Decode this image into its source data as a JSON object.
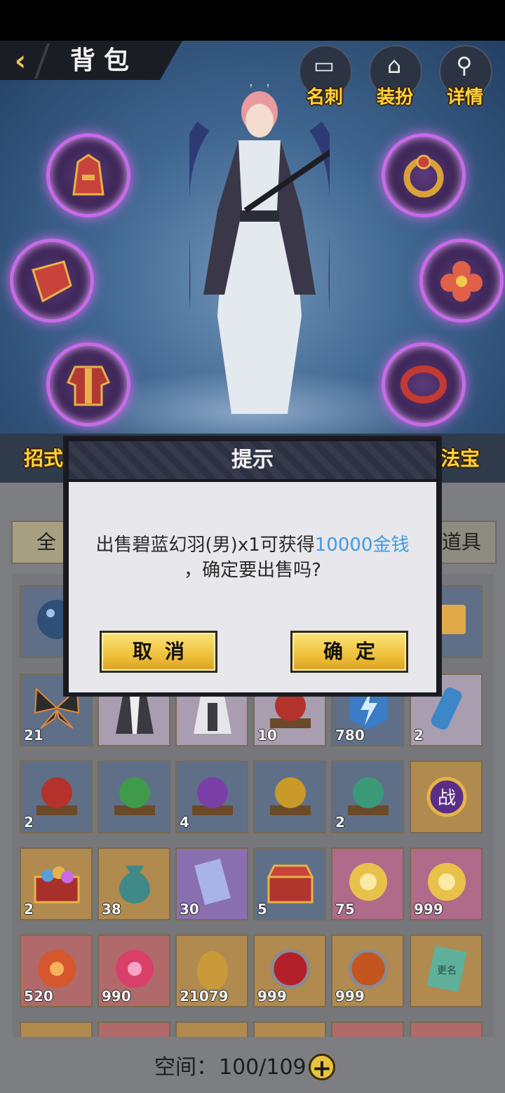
{
  "header": {
    "title": "背包",
    "back_icon": "chevron-left-icon"
  },
  "top_buttons": [
    {
      "label": "名刺",
      "icon": "card-icon"
    },
    {
      "label": "装扮",
      "icon": "costume-icon"
    },
    {
      "label": "详情",
      "icon": "magnifier-icon"
    }
  ],
  "equipment_slots": {
    "left": [
      "helmet-icon",
      "shoulder-icon",
      "armor-icon"
    ],
    "right": [
      "ring-gem-icon",
      "flower-ornament-icon",
      "bracelet-icon"
    ]
  },
  "side_labels": {
    "left": "招式",
    "right": "法宝"
  },
  "filter_tabs": {
    "first": "全",
    "last": "道具"
  },
  "dialog": {
    "title": "提示",
    "message_prefix": "出售碧蓝幻羽(男)x1可获得",
    "message_highlight": "10000金钱",
    "message_suffix": "，确定要出售吗?",
    "cancel_label": "取消",
    "confirm_label": "确定",
    "highlight_color": "#3f9ae0"
  },
  "inventory_rows": [
    [
      {
        "icon": "blue-orb-icon",
        "count": ""
      },
      {
        "icon": "",
        "count": ""
      },
      {
        "icon": "",
        "count": ""
      },
      {
        "icon": "",
        "count": ""
      },
      {
        "icon": "",
        "count": ""
      },
      {
        "icon": "gold-token-icon",
        "count": ""
      }
    ],
    [
      {
        "icon": "butterfly-icon",
        "count": "21"
      },
      {
        "icon": "costume-icon",
        "count": ""
      },
      {
        "icon": "costume-icon",
        "count": ""
      },
      {
        "icon": "red-orb-icon",
        "count": "10"
      },
      {
        "icon": "lightning-stone-icon",
        "count": "780"
      },
      {
        "icon": "battery-icon",
        "count": "2"
      }
    ],
    [
      {
        "icon": "red-orb-icon",
        "count": "2"
      },
      {
        "icon": "green-orb-icon",
        "count": ""
      },
      {
        "icon": "purple-orb-icon",
        "count": "4"
      },
      {
        "icon": "yellow-orb-icon",
        "count": ""
      },
      {
        "icon": "teal-orb-icon",
        "count": "2"
      },
      {
        "icon": "battle-token-icon",
        "count": ""
      }
    ],
    [
      {
        "icon": "orb-chest-icon",
        "count": "2"
      },
      {
        "icon": "pouch-icon",
        "count": "38"
      },
      {
        "icon": "scroll-icon",
        "count": "30"
      },
      {
        "icon": "treasure-chest-icon",
        "count": "5"
      },
      {
        "icon": "lotus-orb-icon",
        "count": "75"
      },
      {
        "icon": "lotus-orb-icon",
        "count": "999"
      }
    ],
    [
      {
        "icon": "fire-orb-icon",
        "count": "520"
      },
      {
        "icon": "pink-lotus-orb-icon",
        "count": "990"
      },
      {
        "icon": "gold-egg-icon",
        "count": "21079"
      },
      {
        "icon": "red-sphere-icon",
        "count": "999"
      },
      {
        "icon": "orange-sphere-icon",
        "count": "999"
      },
      {
        "icon": "rename-card-icon",
        "count": ""
      }
    ]
  ],
  "battle_token_text": "战",
  "rename_card_text": "更名",
  "footer": {
    "space_label": "空间：",
    "space_value": "100/109",
    "add_icon": "plus-icon"
  }
}
